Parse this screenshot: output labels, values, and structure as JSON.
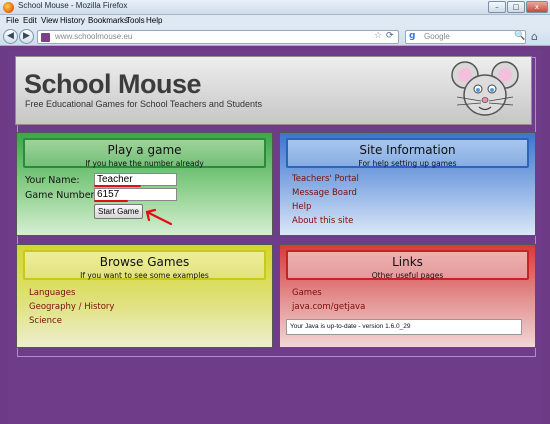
{
  "window": {
    "title": "School Mouse - Mozilla Firefox",
    "buttons": {
      "minimize": "–",
      "maximize": "□",
      "close": "x"
    }
  },
  "menubar": {
    "items": [
      "File",
      "Edit",
      "View",
      "History",
      "Bookmarks",
      "Tools",
      "Help"
    ]
  },
  "navbar": {
    "url": "www.schoolmouse.eu",
    "search_placeholder": "Google",
    "icons": {
      "back": "◀",
      "forward": "▶",
      "star": "☆",
      "reload": "⟳",
      "search": "🔍",
      "home": "⌂",
      "google": "g"
    }
  },
  "header": {
    "title": "School Mouse",
    "tagline": "Free Educational Games for School Teachers and Students"
  },
  "play": {
    "heading": "Play a game",
    "subheading": "If you have the number already",
    "name_label": "Your Name:",
    "name_value": "Teacher",
    "number_label": "Game Number:",
    "number_value": "6157",
    "start_button": "Start Game"
  },
  "site_info": {
    "heading": "Site Information",
    "subheading": "For help setting up games",
    "links": [
      "Teachers' Portal",
      "Message Board",
      "Help",
      "About this site"
    ]
  },
  "browse": {
    "heading": "Browse Games",
    "subheading": "If you want to see some examples",
    "links": [
      "Languages",
      "Geography / History",
      "Science"
    ]
  },
  "links_panel": {
    "heading": "Links",
    "subheading": "Other useful pages",
    "links": [
      "Games",
      "java.com/getjava"
    ],
    "java_status": "Your Java is up-to-date - version 1.6.0_29"
  },
  "colors": {
    "page_background": "#6f3c8a",
    "play_panel": "#3aa64a",
    "site_panel": "#3c74cc",
    "browse_panel": "#d3d62a",
    "links_panel": "#d63a3a",
    "annotation": "#e01010",
    "link_text": "#7b0d0d"
  }
}
